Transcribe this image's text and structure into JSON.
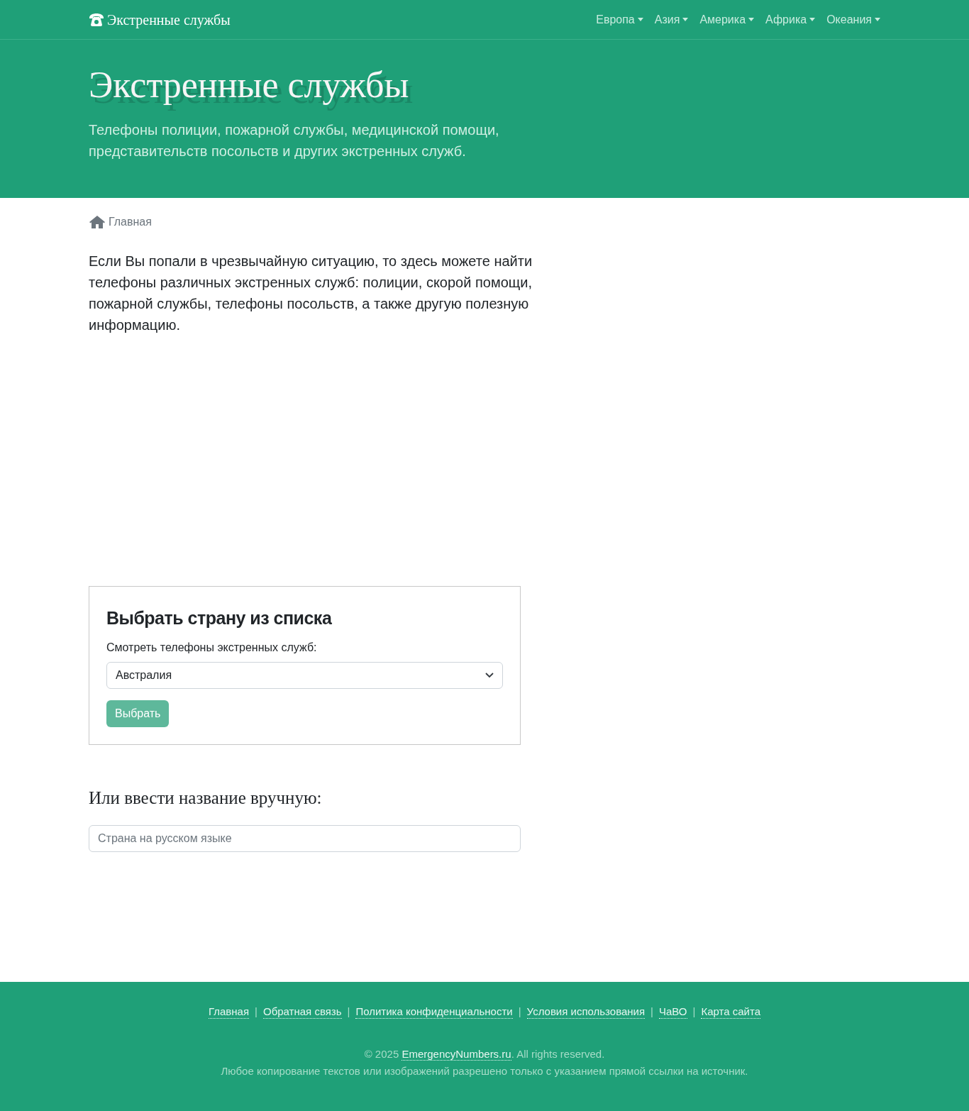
{
  "navbar": {
    "brand": "Экстренные службы",
    "menus": [
      {
        "label": "Европа"
      },
      {
        "label": "Азия"
      },
      {
        "label": "Америка"
      },
      {
        "label": "Африка"
      },
      {
        "label": "Океания"
      }
    ]
  },
  "hero": {
    "title": "Экстренные службы",
    "subtitle": "Телефоны полиции, пожарной службы, медицинской помощи, представительств посольств и других экстренных служб."
  },
  "breadcrumb": "Главная",
  "intro": "Если Вы попали в чрезвычайную ситуацию, то здесь можете найти телефоны различных экстренных служб: полиции, скорой помощи, пожарной службы, телефоны посольств, а также другую полезную информацию.",
  "country_select": {
    "title": "Выбрать страну из списка",
    "label": "Смотреть телефоны экстренных служб:",
    "value": "Австралия",
    "button": "Выбрать"
  },
  "manual": {
    "title": "Или ввести название вручную:",
    "placeholder": "Страна на русском языке"
  },
  "footer": {
    "links": [
      "Главная",
      "Обратная связь",
      "Политика конфиденциальности",
      "Условия использования",
      "ЧаВО",
      "Карта сайта"
    ],
    "separator": "|",
    "copyright_before": "© 2025 ",
    "site_link": "EmergencyNumbers.ru",
    "copyright_after": ". All rights reserved.",
    "notice": "Любое копирование текстов или изображений разрешено только с указанием прямой ссылки на источник."
  }
}
